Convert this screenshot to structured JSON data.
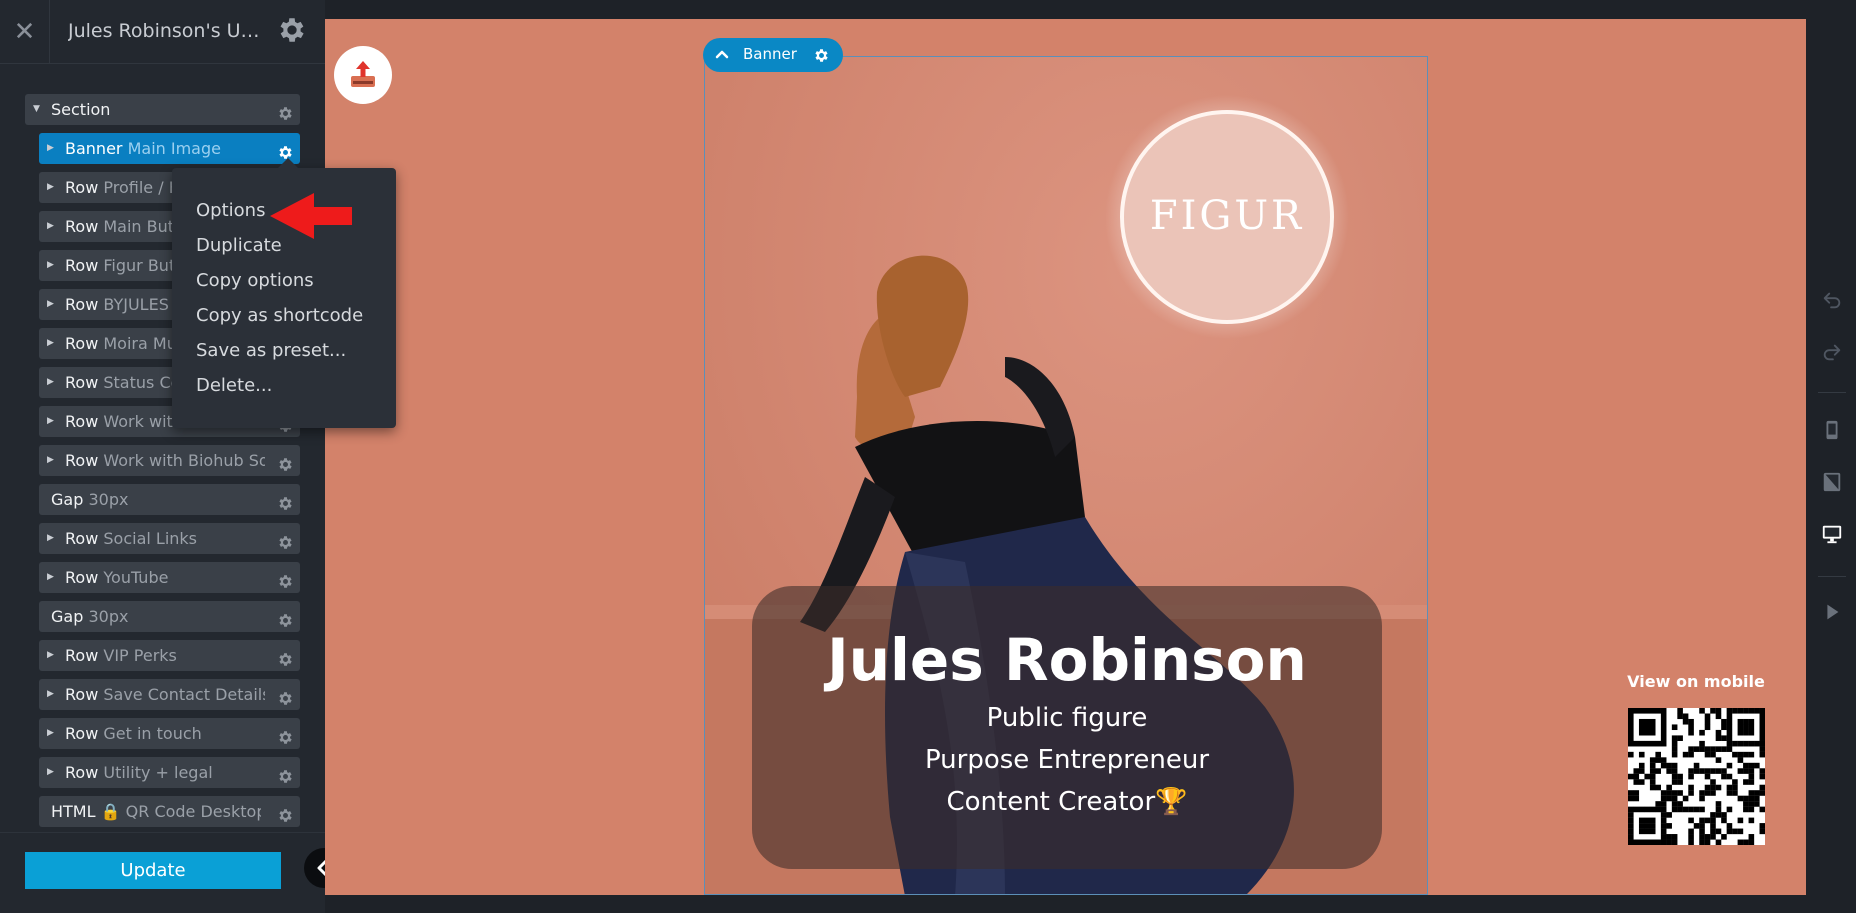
{
  "header": {
    "close_icon": "close-icon",
    "title": "Jules Robinson's Unfi...",
    "settings_icon": "gear-icon"
  },
  "tree": [
    {
      "type": "Section",
      "label": "",
      "level": 0,
      "expanded": true
    },
    {
      "type": "Banner",
      "label": "Main Image",
      "level": 1,
      "active": true
    },
    {
      "type": "Row",
      "label": "Profile / H",
      "level": 1
    },
    {
      "type": "Row",
      "label": "Main Butt",
      "level": 1
    },
    {
      "type": "Row",
      "label": "Figur Butt",
      "level": 1
    },
    {
      "type": "Row",
      "label": "BYJULES B",
      "level": 1
    },
    {
      "type": "Row",
      "label": "Moira Mu",
      "level": 1
    },
    {
      "type": "Row",
      "label": "Status Co",
      "level": 1
    },
    {
      "type": "Row",
      "label": "Work with",
      "level": 1
    },
    {
      "type": "Row",
      "label": "Work with Biohub So...",
      "level": 1
    },
    {
      "type": "Gap",
      "label": "30px",
      "level": 1
    },
    {
      "type": "Row",
      "label": "Social Links",
      "level": 1
    },
    {
      "type": "Row",
      "label": "YouTube",
      "level": 1
    },
    {
      "type": "Gap",
      "label": "30px",
      "level": 1
    },
    {
      "type": "Row",
      "label": "VIP Perks",
      "level": 1
    },
    {
      "type": "Row",
      "label": "Save Contact Details",
      "level": 1
    },
    {
      "type": "Row",
      "label": "Get in touch",
      "level": 1
    },
    {
      "type": "Row",
      "label": "Utility + legal",
      "level": 1
    },
    {
      "type": "HTML",
      "label": "QR Code Desktop",
      "level": 1,
      "locked": true
    }
  ],
  "context_menu": {
    "items": [
      "Options",
      "Duplicate",
      "Copy options",
      "Copy as shortcode",
      "Save as preset...",
      "Delete..."
    ],
    "highlighted": "Options"
  },
  "update_button": "Update",
  "banner_tag": "Banner",
  "banner": {
    "logo_text": "FIGUR",
    "name": "Jules Robinson",
    "tagline_1": "Public figure",
    "tagline_2": "Purpose Entrepreneur",
    "tagline_3": "Content Creator🏆"
  },
  "qr": {
    "label": "View on mobile"
  },
  "right_rail": [
    "undo-icon",
    "redo-icon",
    "mobile-view-icon",
    "tablet-view-icon",
    "desktop-view-icon",
    "preview-play-icon"
  ],
  "colors": {
    "sidebar_bg": "#23282f",
    "node_bg": "#3a4048",
    "active_node": "#0a7fc1",
    "update_button": "#0aa0d6",
    "canvas_bg": "#d3826a",
    "arrow": "#ee1b1b"
  }
}
